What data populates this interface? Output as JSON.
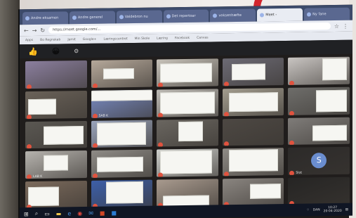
{
  "browser": {
    "tabs": [
      {
        "label": "Andre eksamen"
      },
      {
        "label": "Andre generel"
      },
      {
        "label": "Valdebron nu"
      },
      {
        "label": "Det repertoar"
      },
      {
        "label": "voksenhæfte"
      },
      {
        "label": "Meet - "
      },
      {
        "label": "Ny fane"
      }
    ],
    "url": "https://meet.google.com/...",
    "bookmarks": [
      "Apps",
      "Bo Regnskab",
      "Jamit",
      "Google+",
      "Læringscentret",
      "Min Skole",
      "Læring",
      "Facebook",
      "Canvas"
    ]
  },
  "meet": {
    "emoji_thumb": "👍",
    "emoji_face": "😀"
  },
  "participants": [
    {
      "name": "",
      "bg": "#8b7f9e",
      "papers": []
    },
    {
      "name": "",
      "bg": "#b5a89a",
      "papers": [
        [
          20,
          30,
          50,
          40
        ]
      ]
    },
    {
      "name": "",
      "bg": "#c7c2b9",
      "papers": [
        [
          5,
          15,
          85,
          70
        ]
      ]
    },
    {
      "name": "",
      "bg": "#6c6a74",
      "papers": [
        [
          15,
          20,
          55,
          60
        ]
      ]
    },
    {
      "name": "",
      "bg": "#c9c5c2",
      "papers": [
        [
          55,
          5,
          40,
          80
        ]
      ]
    },
    {
      "name": "",
      "bg": "#6a6259",
      "papers": [
        [
          5,
          30,
          45,
          55
        ]
      ]
    },
    {
      "name": "SAB K",
      "bg": "#7a8cc4",
      "papers": [
        [
          0,
          0,
          100,
          40
        ]
      ]
    },
    {
      "name": "",
      "bg": "#bdbab4",
      "papers": [
        [
          5,
          10,
          90,
          80
        ]
      ]
    },
    {
      "name": "",
      "bg": "#a29c8e",
      "papers": [
        [
          10,
          15,
          80,
          70
        ]
      ]
    },
    {
      "name": "",
      "bg": "#6e6d6a",
      "papers": [
        [
          45,
          10,
          50,
          80
        ]
      ]
    },
    {
      "name": "",
      "bg": "#5a5752",
      "papers": [
        [
          30,
          20,
          65,
          65
        ]
      ]
    },
    {
      "name": "",
      "bg": "#9aa4bb",
      "papers": [
        [
          10,
          10,
          80,
          80
        ]
      ]
    },
    {
      "name": "",
      "bg": "#6a6660",
      "papers": [
        [
          35,
          10,
          40,
          70
        ]
      ]
    },
    {
      "name": "",
      "bg": "#4d4843",
      "papers": []
    },
    {
      "name": "",
      "bg": "#7f7c79",
      "papers": [
        [
          40,
          30,
          55,
          55
        ]
      ]
    },
    {
      "name": "LAB K",
      "bg": "#b6b3ae",
      "papers": [
        [
          30,
          15,
          40,
          55
        ]
      ]
    },
    {
      "name": "",
      "bg": "#8e8b86",
      "papers": [
        [
          10,
          25,
          75,
          55
        ]
      ]
    },
    {
      "name": "",
      "bg": "#cfd0cc",
      "papers": [
        [
          5,
          5,
          85,
          85
        ]
      ]
    },
    {
      "name": "",
      "bg": "#8f8b85",
      "papers": [
        [
          10,
          5,
          80,
          80
        ]
      ]
    },
    {
      "name": "Slot",
      "bg": "#2c2a29",
      "papers": []
    },
    {
      "name": "",
      "bg": "#7b6a5c",
      "papers": [
        [
          5,
          20,
          50,
          70
        ]
      ]
    },
    {
      "name": "",
      "bg": "#3d5fa8",
      "papers": [
        [
          25,
          5,
          60,
          80
        ]
      ]
    },
    {
      "name": "",
      "bg": "#a89a8e",
      "papers": [
        [
          10,
          60,
          75,
          40
        ]
      ]
    },
    {
      "name": "",
      "bg": "#8a8580",
      "papers": [
        [
          45,
          20,
          50,
          55
        ]
      ]
    },
    {
      "name": "",
      "bg": "#262524",
      "papers": []
    }
  ],
  "avatar_letter": "S",
  "taskbar": {
    "time": "10:27",
    "date": "20-04-2020",
    "lang": "DAN"
  }
}
